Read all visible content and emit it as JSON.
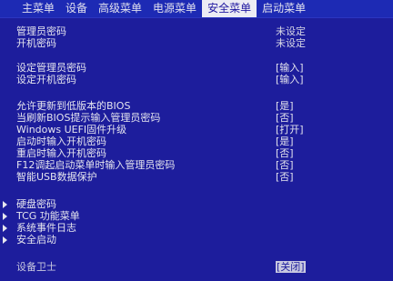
{
  "menubar": {
    "tabs": [
      {
        "label": "主菜单",
        "active": false
      },
      {
        "label": "设备",
        "active": false
      },
      {
        "label": "高级菜单",
        "active": false
      },
      {
        "label": "电源菜单",
        "active": false
      },
      {
        "label": "安全菜单",
        "active": true
      },
      {
        "label": "启动菜单",
        "active": false
      }
    ]
  },
  "status": {
    "admin_password_label": "管理员密码",
    "admin_password_value": "未设定",
    "power_on_password_label": "开机密码",
    "power_on_password_value": "未设定"
  },
  "settings": {
    "set_admin_password_label": "设定管理员密码",
    "set_admin_password_value": "[输入]",
    "set_power_on_password_label": "设定开机密码",
    "set_power_on_password_value": "[输入]",
    "allow_bios_downgrade_label": "允许更新到低版本的BIOS",
    "allow_bios_downgrade_value": "[是]",
    "bios_update_prompt_label": "当刷新BIOS提示输入管理员密码",
    "bios_update_prompt_value": "[否]",
    "uefi_firmware_update_label": "Windows UEFI固件升级",
    "uefi_firmware_update_value": "[打开]",
    "boot_password_prompt_label": "启动时输入开机密码",
    "boot_password_prompt_value": "[是]",
    "reboot_password_prompt_label": "重启时输入开机密码",
    "reboot_password_prompt_value": "[否]",
    "f12_admin_password_label": "F12调起启动菜单时输入管理员密码",
    "f12_admin_password_value": "[否]",
    "smart_usb_protection_label": "智能USB数据保护",
    "smart_usb_protection_value": "[否]"
  },
  "submenus": [
    {
      "label": "硬盘密码"
    },
    {
      "label": "TCG 功能菜单"
    },
    {
      "label": "系统事件日志"
    },
    {
      "label": "安全启动"
    }
  ],
  "footer": {
    "device_guard_label": "设备卫士",
    "device_guard_value": "[关闭]"
  }
}
